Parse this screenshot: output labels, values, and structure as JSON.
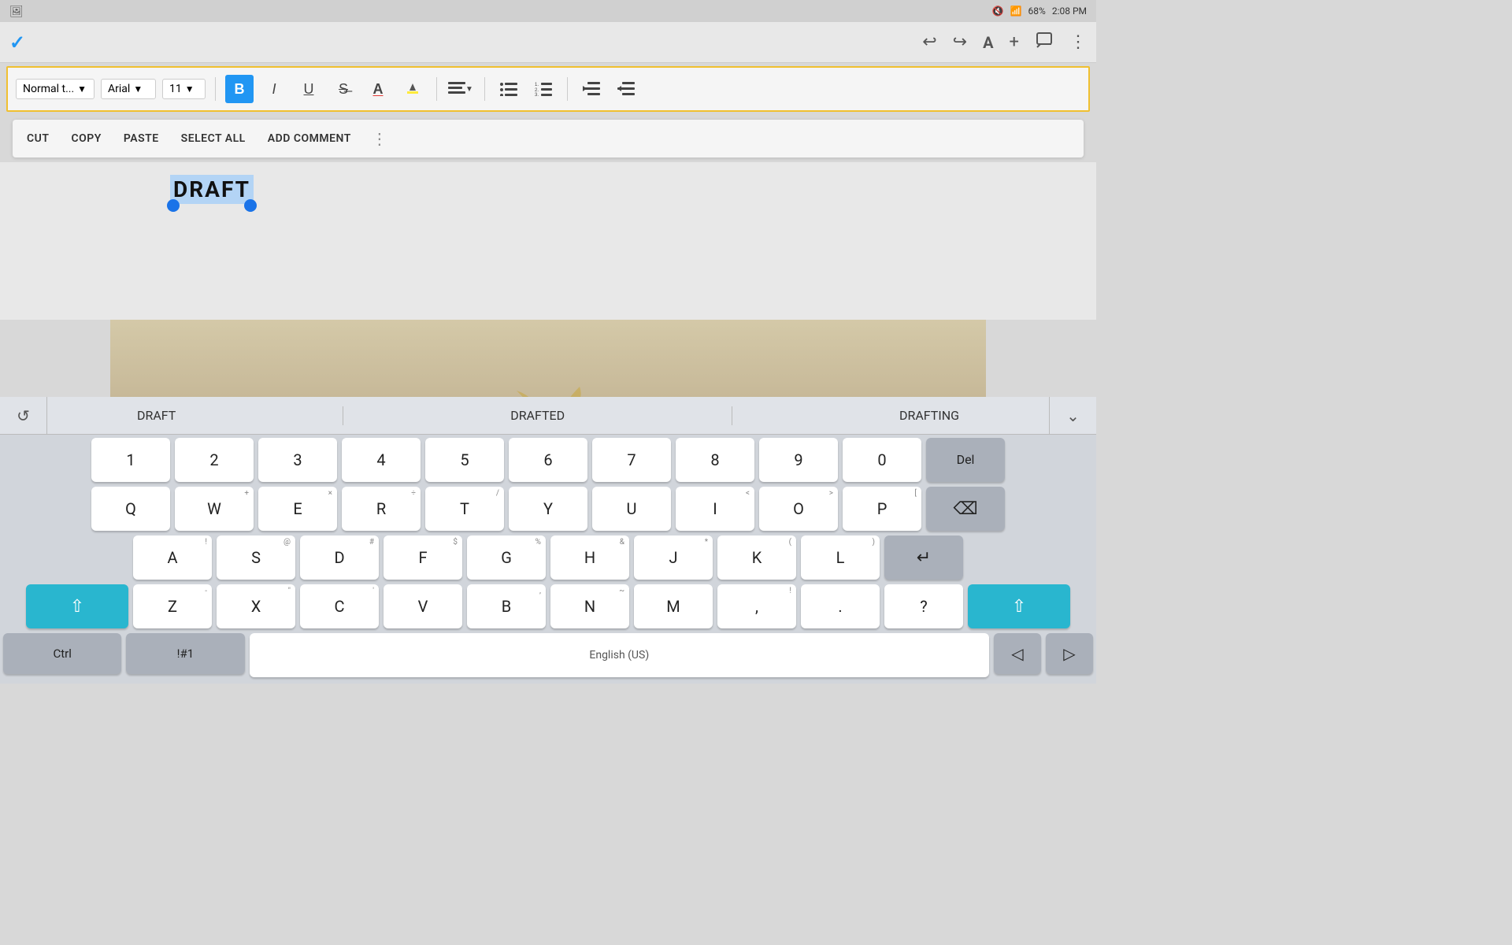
{
  "statusBar": {
    "time": "2:08 PM",
    "battery": "68%",
    "signal": "wifi"
  },
  "topToolbar": {
    "checkmark": "✓",
    "undoIcon": "↩",
    "redoIcon": "↪",
    "fontSizeIcon": "A",
    "addIcon": "+",
    "commentIcon": "💬",
    "moreIcon": "⋮"
  },
  "formattingToolbar": {
    "textStyle": "Normal t...",
    "font": "Arial",
    "fontSize": "11",
    "boldLabel": "B",
    "italicLabel": "I",
    "underlineLabel": "U",
    "strikeLabel": "S",
    "fontColorLabel": "A",
    "highlightLabel": "✏",
    "alignLabel": "≡",
    "bulletLabel": "≡",
    "numberedLabel": "≡",
    "decreaseIndentLabel": "←",
    "increaseIndentLabel": "→"
  },
  "contextMenu": {
    "cut": "CUT",
    "copy": "COPY",
    "paste": "PASTE",
    "selectAll": "SELECT ALL",
    "addComment": "ADD COMMENT",
    "more": "⋮"
  },
  "document": {
    "selectedText": "DRAFT"
  },
  "autocomplete": {
    "suggestions": [
      "DRAFT",
      "DRAFTED",
      "DRAFTING"
    ],
    "icon": "↺",
    "arrowDown": "⌄"
  },
  "keyboard": {
    "row1": [
      {
        "main": "1",
        "secondary": ""
      },
      {
        "main": "2",
        "secondary": ""
      },
      {
        "main": "3",
        "secondary": ""
      },
      {
        "main": "4",
        "secondary": ""
      },
      {
        "main": "5",
        "secondary": ""
      },
      {
        "main": "6",
        "secondary": ""
      },
      {
        "main": "7",
        "secondary": ""
      },
      {
        "main": "8",
        "secondary": ""
      },
      {
        "main": "9",
        "secondary": ""
      },
      {
        "main": "0",
        "secondary": ""
      }
    ],
    "row2": [
      {
        "main": "Q",
        "secondary": ""
      },
      {
        "main": "W",
        "secondary": "+"
      },
      {
        "main": "E",
        "secondary": "×"
      },
      {
        "main": "R",
        "secondary": "÷"
      },
      {
        "main": "T",
        "secondary": "/"
      },
      {
        "main": "Y",
        "secondary": ""
      },
      {
        "main": "U",
        "secondary": ""
      },
      {
        "main": "I",
        "secondary": "<"
      },
      {
        "main": "O",
        "secondary": ">"
      },
      {
        "main": "P",
        "secondary": "["
      }
    ],
    "row3": [
      {
        "main": "A",
        "secondary": "!"
      },
      {
        "main": "S",
        "secondary": "@"
      },
      {
        "main": "D",
        "secondary": "#"
      },
      {
        "main": "F",
        "secondary": "$"
      },
      {
        "main": "G",
        "secondary": "%"
      },
      {
        "main": "H",
        "secondary": "&"
      },
      {
        "main": "J",
        "secondary": "*"
      },
      {
        "main": "K",
        "secondary": "("
      },
      {
        "main": "L",
        "secondary": ")"
      }
    ],
    "row4": [
      {
        "main": "Z",
        "secondary": "-"
      },
      {
        "main": "X",
        "secondary": "\""
      },
      {
        "main": "C",
        "secondary": "'"
      },
      {
        "main": "V",
        "secondary": ""
      },
      {
        "main": "B",
        "secondary": ","
      },
      {
        "main": "N",
        "secondary": "~"
      },
      {
        "main": "M",
        "secondary": ""
      },
      {
        "main": ",",
        "secondary": "!"
      },
      {
        "main": ".",
        "secondary": ""
      },
      {
        "main": "?",
        "secondary": ""
      }
    ],
    "spacebarLabel": "English (US)",
    "deleteLabel": "Del",
    "backspaceSymbol": "⌫",
    "enterSymbol": "↵",
    "shiftSymbol": "⇧",
    "ctrlLabel": "Ctrl",
    "symLabel": "!#1",
    "leftArrow": "◁",
    "rightArrow": "▷"
  }
}
